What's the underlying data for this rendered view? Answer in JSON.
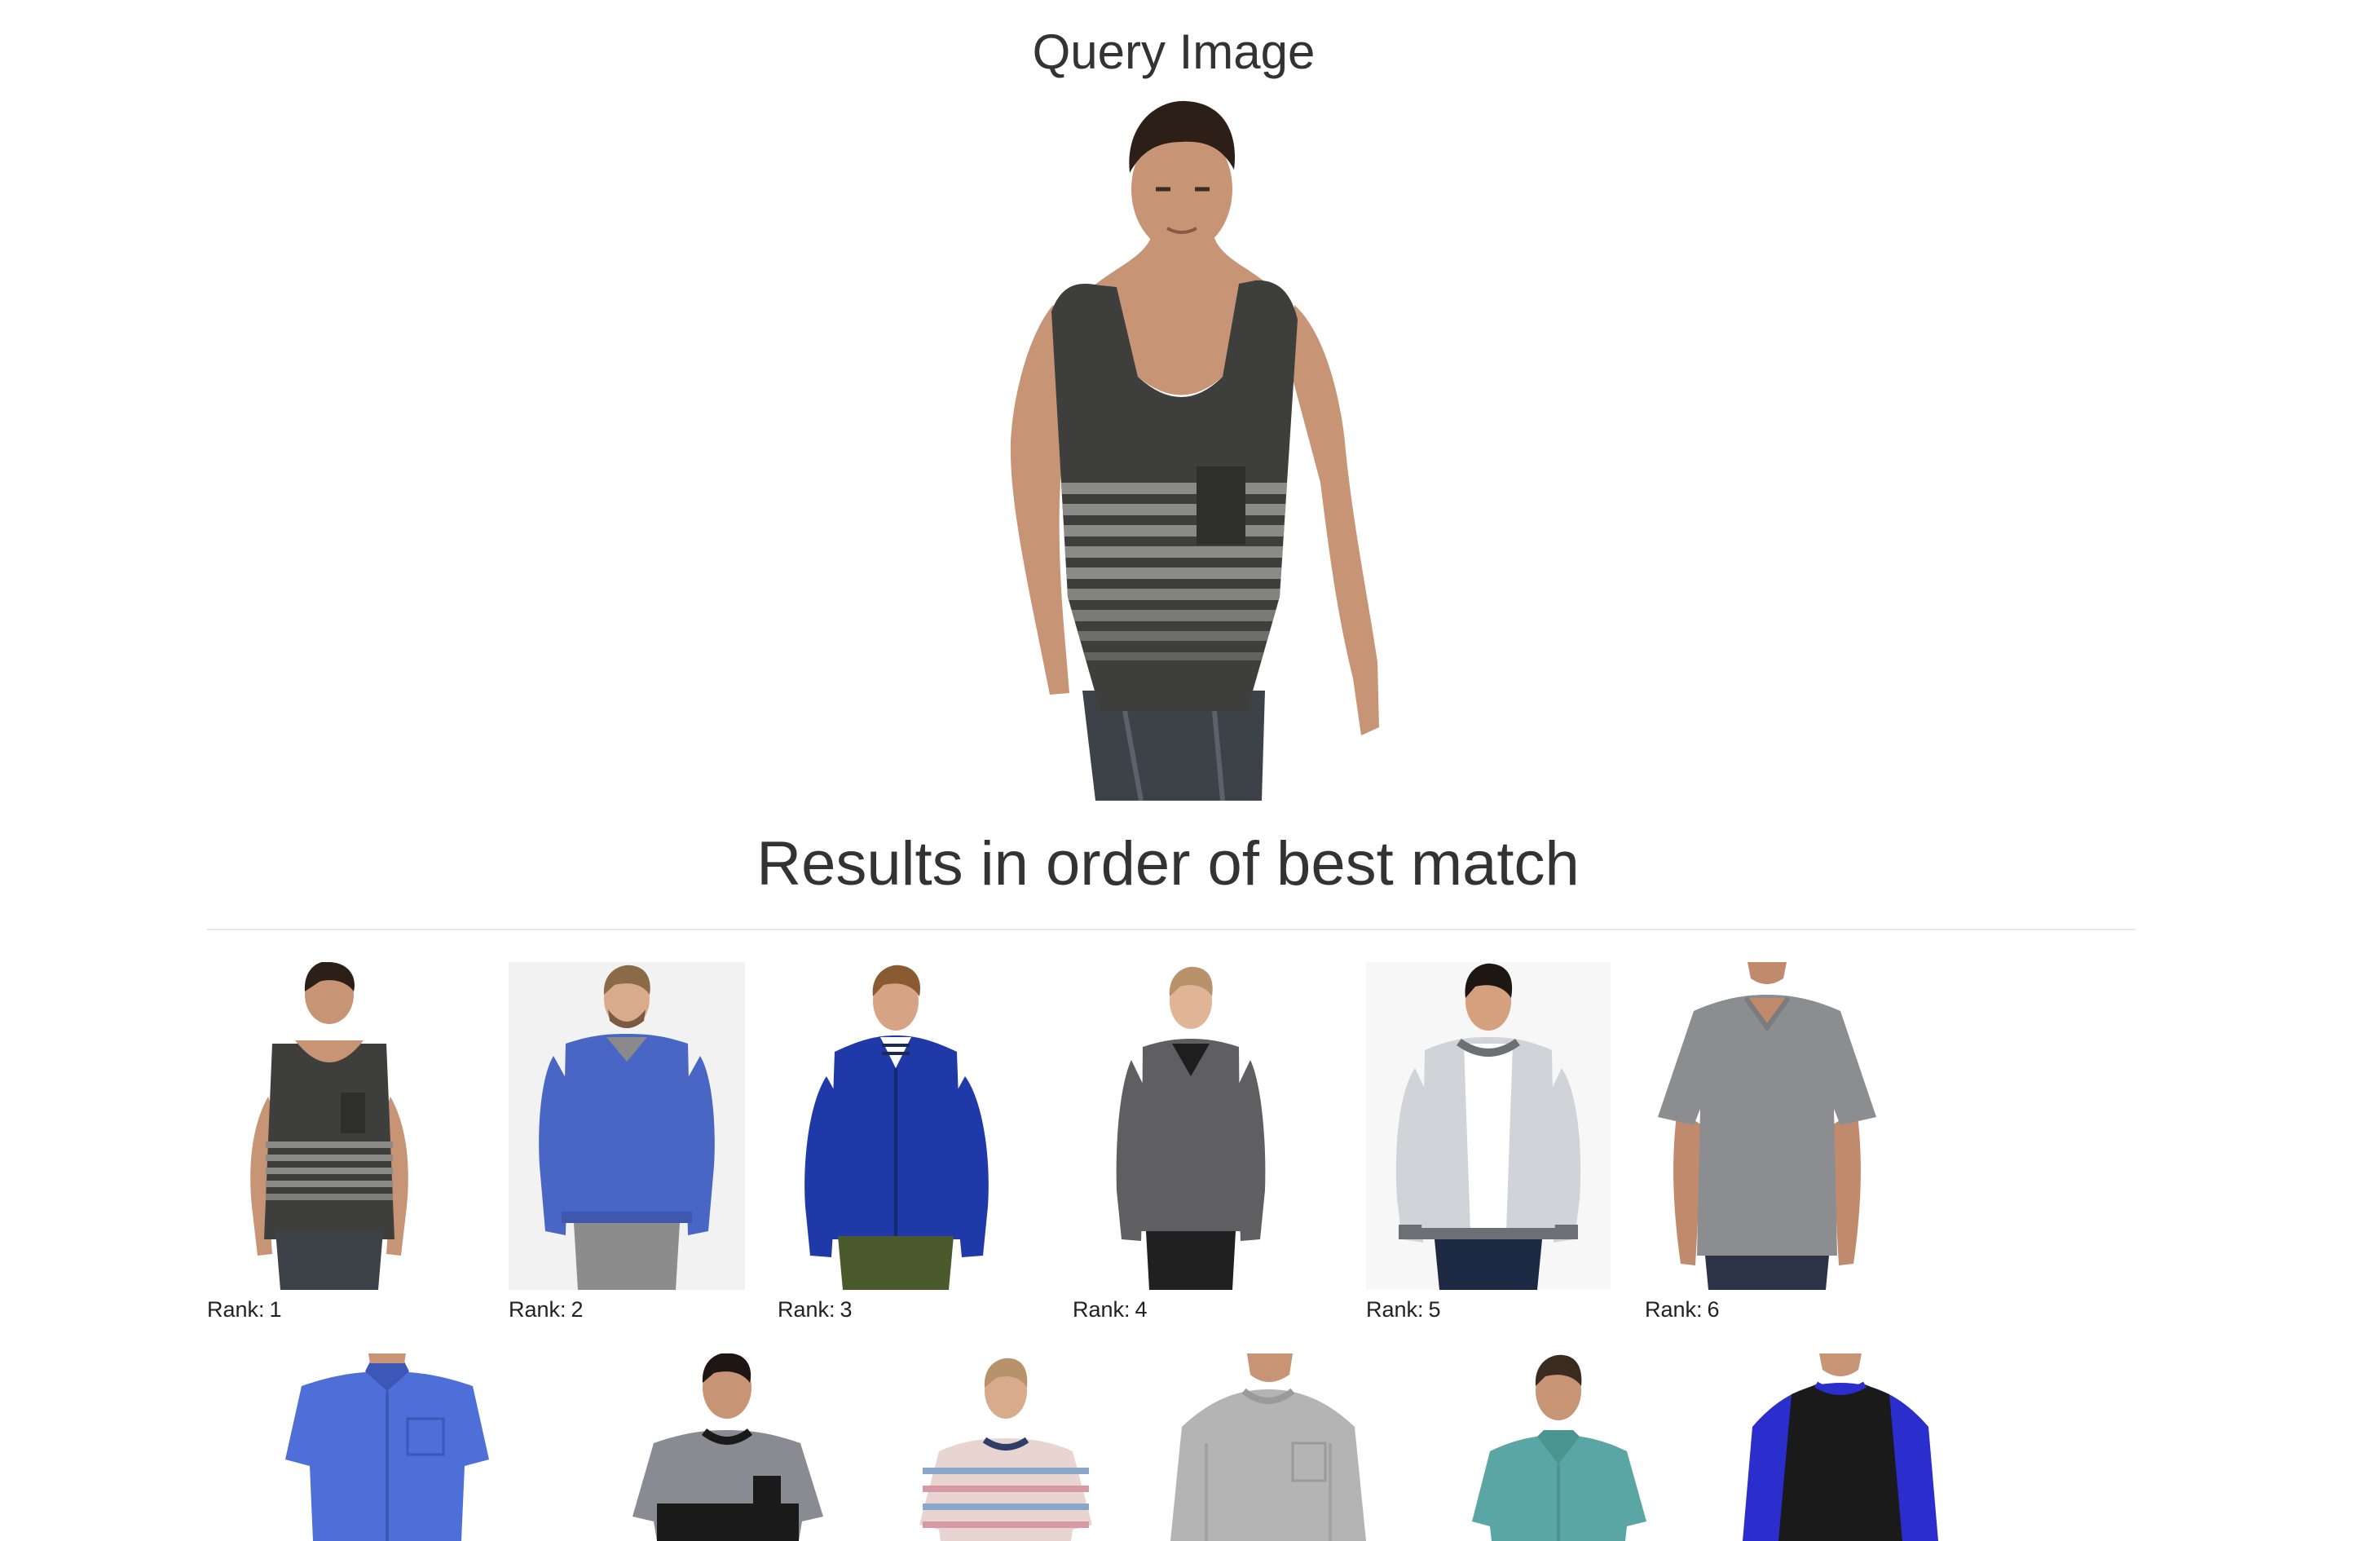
{
  "page": {
    "query_heading": "Query Image",
    "results_heading": "Results in order of best match"
  },
  "query_image": {
    "icon": "person-in-striped-tank-top-image",
    "garment": "dark grey tank top with grey horizontal stripes and chest pocket",
    "colors": {
      "garment": "#3e3e3c",
      "stripe": "#8a8a86",
      "jeans": "#3d4248",
      "skin": "#c79475",
      "hair": "#2b1f18"
    }
  },
  "rank_prefix": "Rank:",
  "results": [
    {
      "rank": "1",
      "icon": "striped-tank-top-image",
      "colors": {
        "garment": "#3e3e3c",
        "stripe": "#8a8a86",
        "lower": "#3d4248",
        "bg": "#ffffff"
      }
    },
    {
      "rank": "2",
      "icon": "blue-sweater-image",
      "colors": {
        "garment": "#4a66c4",
        "stripe": "",
        "lower": "#8c8c8c",
        "bg": "#f2f2f2"
      }
    },
    {
      "rank": "3",
      "icon": "blue-jacket-image",
      "colors": {
        "garment": "#1f3aa8",
        "stripe": "",
        "lower": "#4b5a2c",
        "bg": "#ffffff"
      }
    },
    {
      "rank": "4",
      "icon": "grey-v-neck-sweater-image",
      "colors": {
        "garment": "#5f5f62",
        "stripe": "",
        "lower": "#202020",
        "bg": "#ffffff"
      }
    },
    {
      "rank": "5",
      "icon": "light-grey-bomber-jacket-image",
      "colors": {
        "garment": "#d2d3d8",
        "stripe": "",
        "lower": "#1e2a44",
        "bg": "#f7f7f7"
      }
    },
    {
      "rank": "6",
      "icon": "grey-v-neck-tshirt-image",
      "colors": {
        "garment": "#8c8d90",
        "stripe": "",
        "lower": "#2b3446",
        "bg": "#ffffff"
      }
    }
  ],
  "more_results": [
    {
      "icon": "blue-short-sleeve-shirt-image",
      "colors": {
        "garment": "#4e6fd8"
      }
    },
    {
      "icon": "grey-black-colorblock-tee-image",
      "colors": {
        "garment": "#8a8a92"
      }
    },
    {
      "icon": "striped-crewneck-tee-image",
      "colors": {
        "garment": "#e8d4d0"
      }
    },
    {
      "icon": "grey-long-sleeve-tee-image",
      "colors": {
        "garment": "#b4b4b4"
      }
    },
    {
      "icon": "teal-camp-shirt-image",
      "colors": {
        "garment": "#5aa6a4"
      }
    },
    {
      "icon": "black-blue-raglan-tee-image",
      "colors": {
        "garment": "#1a1a1a"
      }
    }
  ]
}
